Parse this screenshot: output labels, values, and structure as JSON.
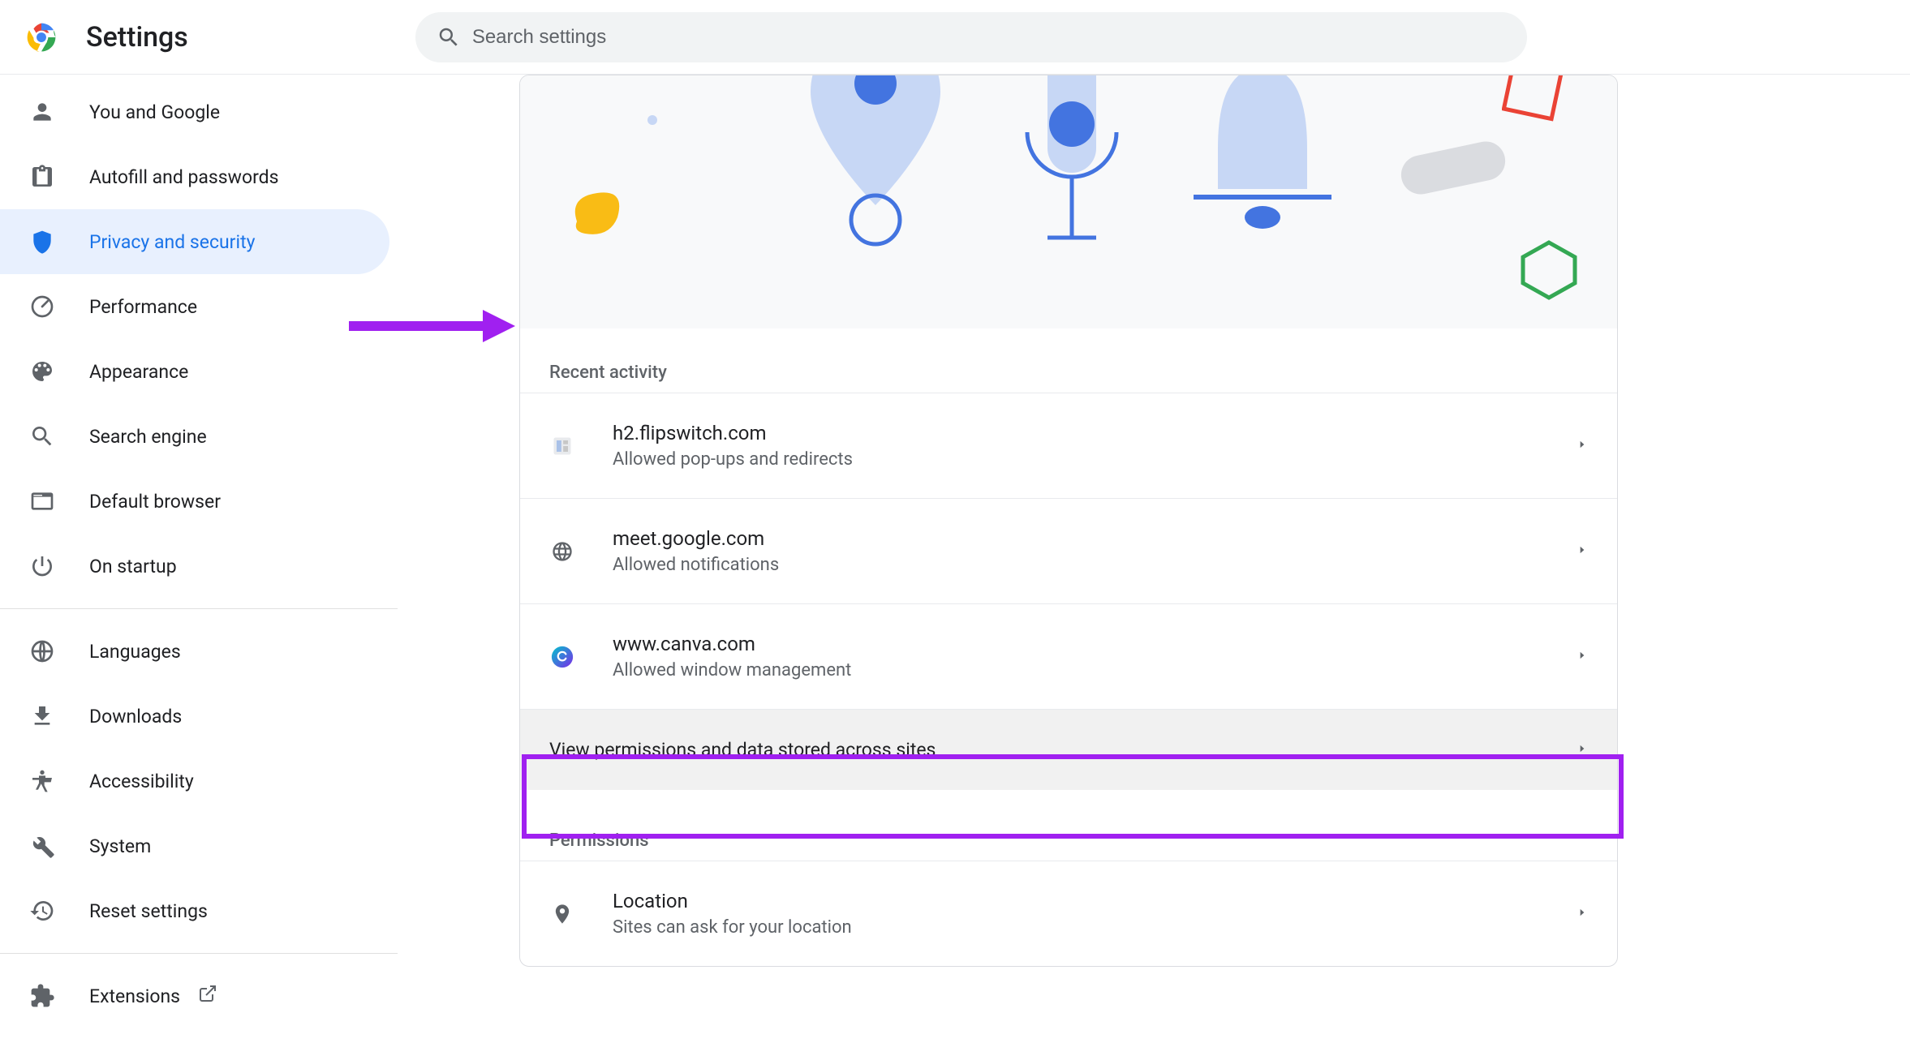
{
  "header": {
    "title": "Settings",
    "search_placeholder": "Search settings"
  },
  "sidebar": {
    "items": [
      {
        "id": "you-google",
        "label": "You and Google",
        "icon": "person",
        "active": false
      },
      {
        "id": "autofill",
        "label": "Autofill and passwords",
        "icon": "clipboard",
        "active": false
      },
      {
        "id": "privacy",
        "label": "Privacy and security",
        "icon": "shield",
        "active": true
      },
      {
        "id": "performance",
        "label": "Performance",
        "icon": "speedometer",
        "active": false
      },
      {
        "id": "appearance",
        "label": "Appearance",
        "icon": "palette",
        "active": false
      },
      {
        "id": "search-engine",
        "label": "Search engine",
        "icon": "search",
        "active": false
      },
      {
        "id": "default-browser",
        "label": "Default browser",
        "icon": "browser-window",
        "active": false
      },
      {
        "id": "on-startup",
        "label": "On startup",
        "icon": "power",
        "active": false
      }
    ],
    "items2": [
      {
        "id": "languages",
        "label": "Languages",
        "icon": "globe"
      },
      {
        "id": "downloads",
        "label": "Downloads",
        "icon": "download"
      },
      {
        "id": "accessibility",
        "label": "Accessibility",
        "icon": "accessibility"
      },
      {
        "id": "system",
        "label": "System",
        "icon": "wrench"
      },
      {
        "id": "reset",
        "label": "Reset settings",
        "icon": "history"
      }
    ],
    "items3": [
      {
        "id": "extensions",
        "label": "Extensions",
        "icon": "extension",
        "external": true
      }
    ]
  },
  "main": {
    "recent_activity_title": "Recent activity",
    "recent": [
      {
        "site": "h2.flipswitch.com",
        "detail": "Allowed pop-ups and redirects",
        "favicon": "doc"
      },
      {
        "site": "meet.google.com",
        "detail": "Allowed notifications",
        "favicon": "globe-gray"
      },
      {
        "site": "www.canva.com",
        "detail": "Allowed window management",
        "favicon": "canva"
      }
    ],
    "view_all_label": "View permissions and data stored across sites",
    "permissions_title": "Permissions",
    "permissions": [
      {
        "title": "Location",
        "detail": "Sites can ask for your location",
        "icon": "location-pin"
      }
    ]
  },
  "annotations": {
    "arrow_color": "#a020f0",
    "box_color": "#a020f0"
  }
}
